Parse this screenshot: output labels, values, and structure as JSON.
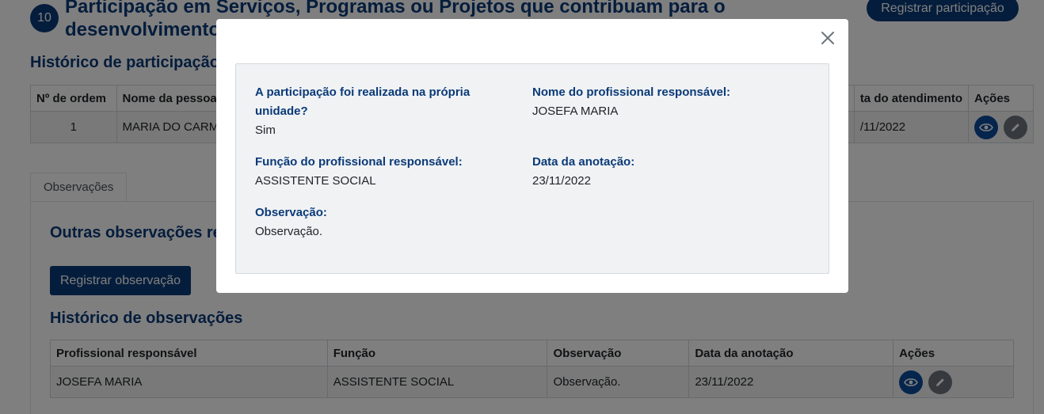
{
  "section": {
    "step_number": "10",
    "title": "Participação em Serviços, Programas ou Projetos que contribuam para o desenvolvimento",
    "register_button": "Registrar participação"
  },
  "participation_history": {
    "title": "Histórico de participação",
    "columns": [
      "Nº de ordem",
      "Nome da pessoa",
      "ta do atendimento",
      "Ações"
    ],
    "rows": [
      {
        "ordem": "1",
        "nome": "MARIA DO CARM",
        "data": "/11/2022"
      }
    ]
  },
  "tabs": [
    {
      "label": "Observações"
    }
  ],
  "observations": {
    "title": "Outras observações ref contribuam para o desenvolvimento da co",
    "register_button": "Registrar observação",
    "history_title": "Histórico de observações",
    "columns": [
      "Profissional responsável",
      "Função",
      "Observação",
      "Data da anotação",
      "Ações"
    ],
    "rows": [
      {
        "profissional": "JOSEFA MARIA",
        "funcao": "ASSISTENTE SOCIAL",
        "observacao": "Observação.",
        "data": "23/11/2022"
      }
    ]
  },
  "modal": {
    "fields": {
      "propria_unidade": {
        "label": "A participação foi realizada na própria unidade?",
        "value": "Sim"
      },
      "nome_profissional": {
        "label": "Nome do profissional responsável:",
        "value": "JOSEFA MARIA"
      },
      "funcao_profissional": {
        "label": "Função do profissional responsável:",
        "value": "ASSISTENTE SOCIAL"
      },
      "data_anotacao": {
        "label": "Data da anotação:",
        "value": "23/11/2022"
      },
      "observacao": {
        "label": "Observação:",
        "value": "Observação."
      }
    }
  },
  "icons": {
    "close": "close-icon",
    "view": "eye-icon",
    "edit": "pencil-icon"
  },
  "colors": {
    "primary": "#0b3a78",
    "view_button": "#0b4a9a",
    "edit_button": "#6c757d",
    "card_background": "#f0f2f4"
  }
}
